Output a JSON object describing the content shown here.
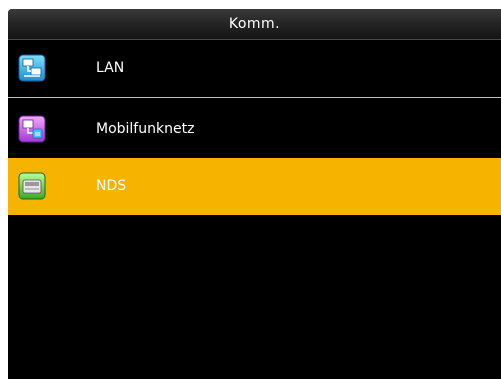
{
  "header": {
    "title": "Komm."
  },
  "menu": {
    "items": [
      {
        "label": "LAN",
        "icon": "lan-network-icon",
        "selected": false
      },
      {
        "label": "Mobilfunknetz",
        "icon": "mobile-network-icon",
        "selected": false
      },
      {
        "label": "NDS",
        "icon": "nds-device-icon",
        "selected": true
      }
    ]
  },
  "colors": {
    "background": "#000000",
    "selection": "#f6b300",
    "separator": "#bdbdbd",
    "text": "#ffffff"
  }
}
